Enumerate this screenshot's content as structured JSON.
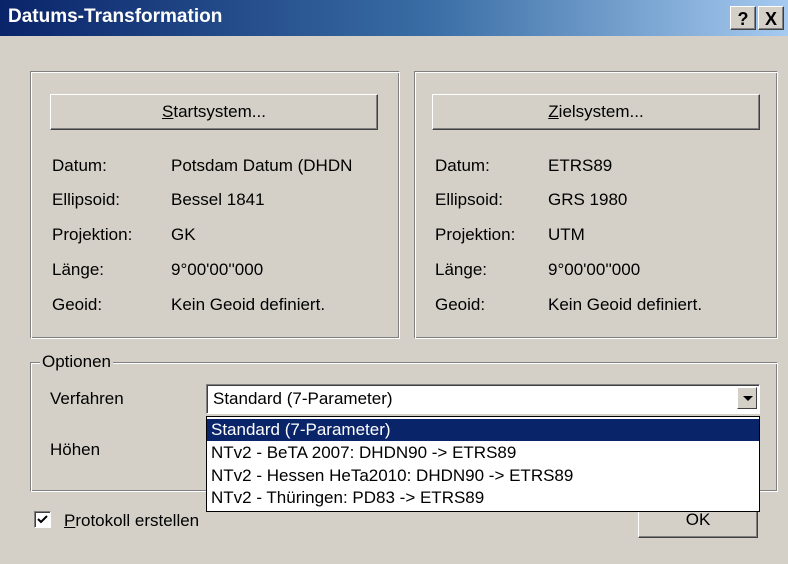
{
  "window": {
    "title": "Datums-Transformation",
    "help_glyph": "?",
    "close_glyph": "X"
  },
  "start_panel": {
    "button": {
      "mnemonic": "S",
      "rest": "tartsystem..."
    },
    "rows": [
      {
        "label": "Datum:",
        "value": "Potsdam Datum (DHDN"
      },
      {
        "label": "Ellipsoid:",
        "value": "Bessel 1841"
      },
      {
        "label": "Projektion:",
        "value": "GK"
      },
      {
        "label": "Länge:",
        "value": "9°00'00''000"
      },
      {
        "label": "Geoid:",
        "value": "Kein Geoid definiert."
      }
    ]
  },
  "target_panel": {
    "button": {
      "mnemonic": "Z",
      "rest": "ielsystem..."
    },
    "rows": [
      {
        "label": "Datum:",
        "value": "ETRS89"
      },
      {
        "label": "Ellipsoid:",
        "value": "GRS 1980"
      },
      {
        "label": "Projektion:",
        "value": "UTM"
      },
      {
        "label": "Länge:",
        "value": "9°00'00''000"
      },
      {
        "label": "Geoid:",
        "value": "Kein Geoid definiert."
      }
    ]
  },
  "options": {
    "legend": "Optionen",
    "method_label": "Verfahren",
    "heights_label": "Höhen",
    "method_selected": "Standard (7-Parameter)",
    "dropdown_items": [
      "Standard (7-Parameter)",
      "NTv2 - BeTA 2007: DHDN90 -> ETRS89",
      "NTv2 - Hessen HeTa2010: DHDN90 -> ETRS89",
      "NTv2 - Thüringen: PD83 -> ETRS89"
    ]
  },
  "protocol_checkbox": {
    "checked": true,
    "mnemonic": "P",
    "rest": "rotokoll erstellen"
  },
  "ok_button": {
    "label": "OK"
  },
  "colors": {
    "dialog_bg": "#d4d0c8",
    "title_start": "#0a246a",
    "title_end": "#a6caf0",
    "selection": "#0a246a"
  },
  "icons": {
    "dropdown": "chevron-down-icon",
    "checkbox": "checkmark-icon"
  }
}
